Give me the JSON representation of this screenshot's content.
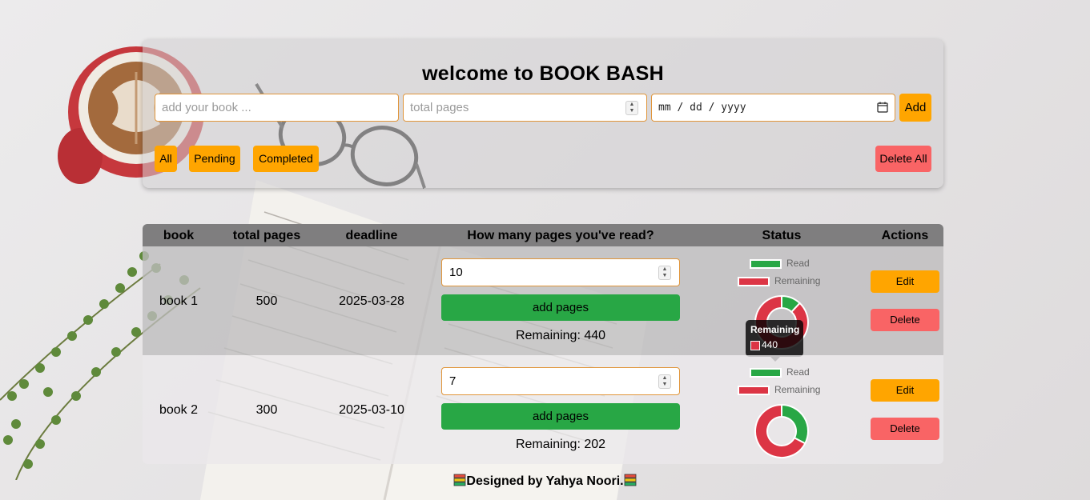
{
  "app": {
    "title": "welcome to BOOK BASH"
  },
  "form": {
    "book_placeholder": "add your book ...",
    "pages_placeholder": "total pages",
    "date_placeholder": "mm / dd / yyyy",
    "add_label": "Add"
  },
  "filters": {
    "all": "All",
    "pending": "Pending",
    "completed": "Completed",
    "delete_all": "Delete All"
  },
  "table": {
    "headers": [
      "book",
      "total pages",
      "deadline",
      "How many pages you've read?",
      "Status",
      "Actions"
    ],
    "rows": [
      {
        "book": "book 1",
        "total_pages": "500",
        "deadline": "2025-03-28",
        "pages_read": "10",
        "add_label": "add pages",
        "remaining_text": "Remaining: 440",
        "legend_read": "Read",
        "legend_remaining": "Remaining",
        "edit_label": "Edit",
        "delete_label": "Delete",
        "tooltip_title": "Remaining",
        "tooltip_value": "440",
        "chart": {
          "read": 60,
          "remaining": 440
        }
      },
      {
        "book": "book 2",
        "total_pages": "300",
        "deadline": "2025-03-10",
        "pages_read": "7",
        "add_label": "add pages",
        "remaining_text": "Remaining: 202",
        "legend_read": "Read",
        "legend_remaining": "Remaining",
        "edit_label": "Edit",
        "delete_label": "Delete",
        "chart": {
          "read": 98,
          "remaining": 202
        }
      }
    ]
  },
  "colors": {
    "accent": "#ffa500",
    "danger": "#f96465",
    "read": "#28a745",
    "remaining": "#dc3545"
  },
  "footer": {
    "text": "Designed by Yahya Noori."
  }
}
